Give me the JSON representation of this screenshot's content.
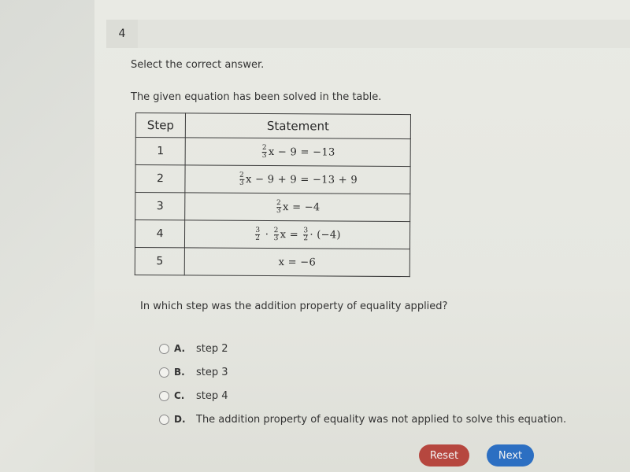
{
  "question_number": "4",
  "instruction": "Select the correct answer.",
  "intro": "The given equation has been solved in the table.",
  "table": {
    "headers": [
      "Step",
      "Statement"
    ],
    "rows": [
      {
        "step": "1",
        "statement_parts": {
          "frac_num": "2",
          "frac_den": "3",
          "rest": "x − 9 = −13"
        }
      },
      {
        "step": "2",
        "statement_parts": {
          "frac_num": "2",
          "frac_den": "3",
          "rest": "x − 9 + 9 = −13 + 9"
        }
      },
      {
        "step": "3",
        "statement_parts": {
          "frac_num": "2",
          "frac_den": "3",
          "rest": "x = −4"
        }
      },
      {
        "step": "4",
        "statement_parts": {
          "a_num": "3",
          "a_den": "2",
          "b_num": "2",
          "b_den": "3",
          "mid": "x = ",
          "c_num": "3",
          "c_den": "2",
          "rest": "· (−4)"
        }
      },
      {
        "step": "5",
        "statement": "x = −6"
      }
    ]
  },
  "question": "In which step was the addition property of equality applied?",
  "options": [
    {
      "letter": "A.",
      "text": "step 2"
    },
    {
      "letter": "B.",
      "text": "step 3"
    },
    {
      "letter": "C.",
      "text": "step 4"
    },
    {
      "letter": "D.",
      "text": "The addition property of equality was not applied to solve this equation."
    }
  ],
  "buttons": {
    "reset": "Reset",
    "next": "Next"
  },
  "colors": {
    "reset": "#b6473f",
    "next": "#2c6fc2"
  }
}
